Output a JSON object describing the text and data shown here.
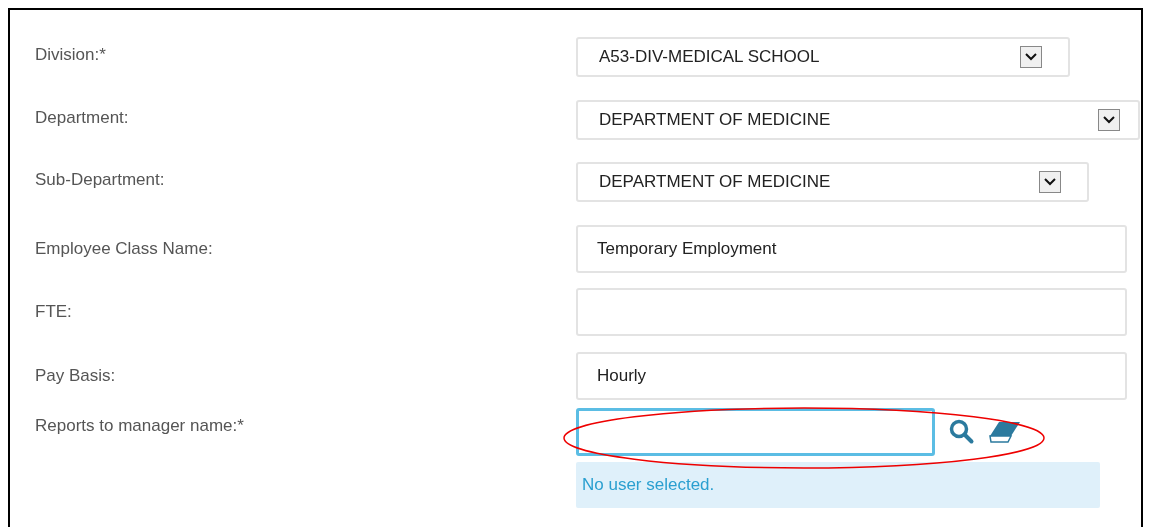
{
  "fields": [
    {
      "label": "Division:*",
      "kind": "select",
      "value": "A53-DIV-MEDICAL SCHOOL"
    },
    {
      "label": "Department:",
      "kind": "select",
      "value": "DEPARTMENT OF MEDICINE"
    },
    {
      "label": "Sub-Department:",
      "kind": "select",
      "value": "DEPARTMENT OF MEDICINE"
    },
    {
      "label": "Employee Class Name:",
      "kind": "text",
      "value": "Temporary Employment"
    },
    {
      "label": "FTE:",
      "kind": "text"
    },
    {
      "label": "Pay Basis:",
      "kind": "text",
      "value": "Hourly"
    },
    {
      "label": "Reports to manager name:*",
      "kind": "lookup",
      "focused": true,
      "message": "No user selected."
    }
  ]
}
